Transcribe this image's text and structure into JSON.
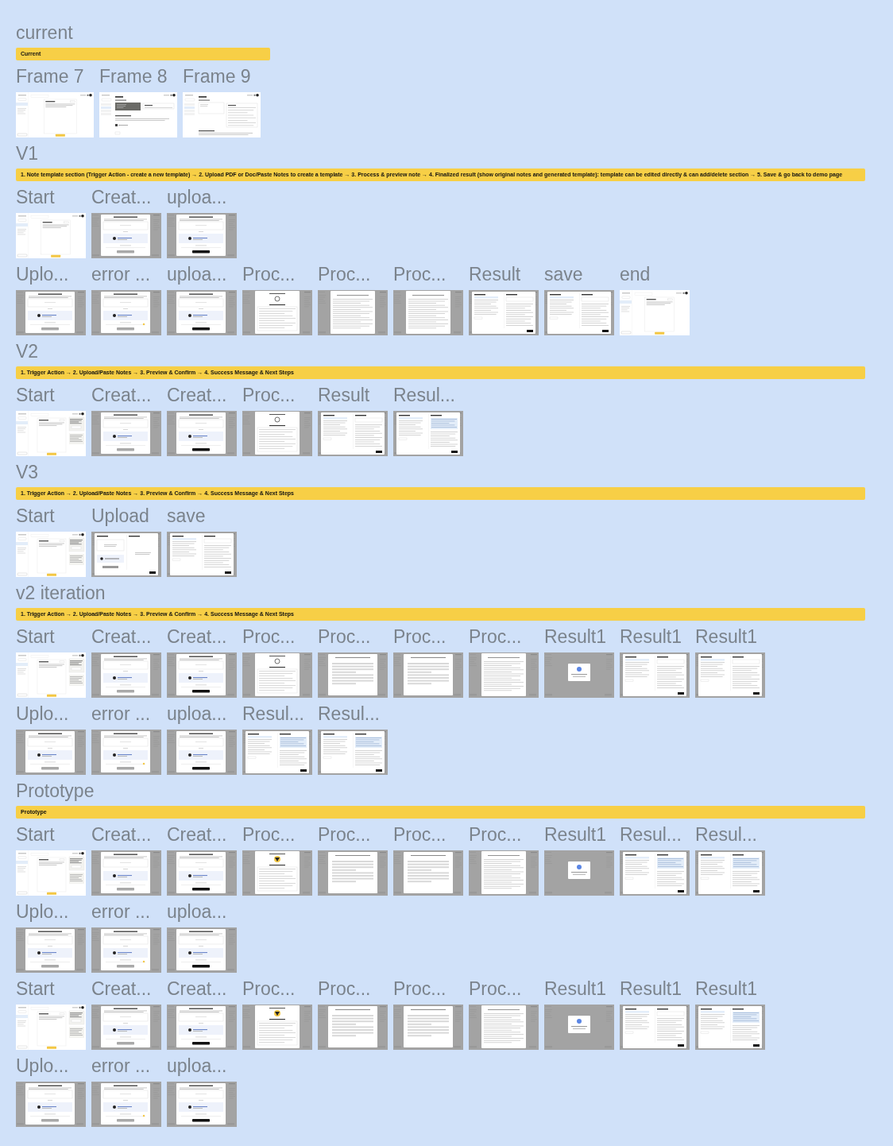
{
  "sections": [
    {
      "title": "current",
      "banner": {
        "text": "Current",
        "full_width": false
      },
      "wide_frames": true,
      "rows": [
        [
          {
            "name": "Frame 7",
            "kind": "page"
          },
          {
            "name": "Frame 8",
            "kind": "settings-dark"
          },
          {
            "name": "Frame 9",
            "kind": "settings"
          }
        ]
      ]
    },
    {
      "title": "V1",
      "banner": {
        "text": "1. Note template section (Trigger Action - create a new template) → 2. Upload PDF or Doc/Paste Notes to create a template → 3. Process & preview note → 4. Finalized result (show original notes and generated template): template can be edited directly & can add/delete section → 5. Save & go back to demo page",
        "full_width": true
      },
      "wide_frames": false,
      "rows": [
        [
          {
            "name": "Start",
            "kind": "page"
          },
          {
            "name": "Creat...",
            "kind": "modal"
          },
          {
            "name": "uploa...",
            "kind": "modal-dark"
          }
        ],
        [
          {
            "name": "Uplo...",
            "kind": "modal"
          },
          {
            "name": "error ...",
            "kind": "modal-error"
          },
          {
            "name": "uploa...",
            "kind": "modal-dark"
          },
          {
            "name": "Proc...",
            "kind": "loading"
          },
          {
            "name": "Proc...",
            "kind": "text"
          },
          {
            "name": "Proc...",
            "kind": "text"
          },
          {
            "name": "Result",
            "kind": "split"
          },
          {
            "name": "save",
            "kind": "split"
          },
          {
            "name": "end",
            "kind": "page"
          }
        ]
      ]
    },
    {
      "title": "V2",
      "banner": {
        "text": "1. Trigger Action → 2. Upload/Paste Notes → 3. Preview & Confirm → 4. Success Message & Next Steps",
        "full_width": true
      },
      "wide_frames": false,
      "rows": [
        [
          {
            "name": "Start",
            "kind": "page-panel"
          },
          {
            "name": "Creat...",
            "kind": "modal"
          },
          {
            "name": "Creat...",
            "kind": "modal-dark"
          },
          {
            "name": "Proc...",
            "kind": "loading"
          },
          {
            "name": "Result",
            "kind": "split"
          },
          {
            "name": "Resul...",
            "kind": "split-blue"
          }
        ]
      ]
    },
    {
      "title": "V3",
      "banner": {
        "text": "1. Trigger Action → 2. Upload/Paste Notes → 3. Preview & Confirm → 4. Success Message & Next Steps",
        "full_width": true
      },
      "wide_frames": false,
      "rows": [
        [
          {
            "name": "Start",
            "kind": "page-panel"
          },
          {
            "name": "Upload",
            "kind": "split-upload"
          },
          {
            "name": "save",
            "kind": "split"
          }
        ]
      ]
    },
    {
      "title": "v2 iteration",
      "banner": {
        "text": "1. Trigger Action → 2. Upload/Paste Notes → 3. Preview & Confirm → 4. Success Message & Next Steps",
        "full_width": true
      },
      "wide_frames": false,
      "rows": [
        [
          {
            "name": "Start",
            "kind": "page-panel"
          },
          {
            "name": "Creat...",
            "kind": "modal"
          },
          {
            "name": "Creat...",
            "kind": "modal-dark"
          },
          {
            "name": "Proc...",
            "kind": "loading"
          },
          {
            "name": "Proc...",
            "kind": "lines"
          },
          {
            "name": "Proc...",
            "kind": "lines"
          },
          {
            "name": "Proc...",
            "kind": "text"
          },
          {
            "name": "Result1",
            "kind": "dialog"
          },
          {
            "name": "Result1",
            "kind": "split"
          },
          {
            "name": "Result1",
            "kind": "split"
          }
        ],
        [
          {
            "name": "Uplo...",
            "kind": "modal"
          },
          {
            "name": "error ...",
            "kind": "modal-error"
          },
          {
            "name": "uploa...",
            "kind": "modal-dark"
          },
          {
            "name": "Resul...",
            "kind": "split-blue"
          },
          {
            "name": "Resul...",
            "kind": "split-blue"
          }
        ]
      ]
    },
    {
      "title": "Prototype",
      "banner": {
        "text": "Prototype",
        "full_width": true
      },
      "wide_frames": false,
      "rows": [
        [
          {
            "name": "Start",
            "kind": "page-panel"
          },
          {
            "name": "Creat...",
            "kind": "modal"
          },
          {
            "name": "Creat...",
            "kind": "modal-dark"
          },
          {
            "name": "Proc...",
            "kind": "loading-yellow"
          },
          {
            "name": "Proc...",
            "kind": "lines"
          },
          {
            "name": "Proc...",
            "kind": "lines"
          },
          {
            "name": "Proc...",
            "kind": "text"
          },
          {
            "name": "Result1",
            "kind": "dialog"
          },
          {
            "name": "Resul...",
            "kind": "split-blue"
          },
          {
            "name": "Resul...",
            "kind": "split-blue"
          }
        ],
        [
          {
            "name": "Uplo...",
            "kind": "modal"
          },
          {
            "name": "error ...",
            "kind": "modal-error"
          },
          {
            "name": "uploa...",
            "kind": "modal-dark"
          }
        ],
        [
          {
            "name": "Start",
            "kind": "page-panel"
          },
          {
            "name": "Creat...",
            "kind": "modal"
          },
          {
            "name": "Creat...",
            "kind": "modal-dark"
          },
          {
            "name": "Proc...",
            "kind": "loading-yellow"
          },
          {
            "name": "Proc...",
            "kind": "lines"
          },
          {
            "name": "Proc...",
            "kind": "lines"
          },
          {
            "name": "Proc...",
            "kind": "text"
          },
          {
            "name": "Result1",
            "kind": "dialog"
          },
          {
            "name": "Result1",
            "kind": "split"
          },
          {
            "name": "Result1",
            "kind": "split-blue"
          }
        ],
        [
          {
            "name": "Uplo...",
            "kind": "modal"
          },
          {
            "name": "error ...",
            "kind": "modal-error"
          },
          {
            "name": "uploa...",
            "kind": "modal-dark"
          }
        ]
      ]
    }
  ]
}
